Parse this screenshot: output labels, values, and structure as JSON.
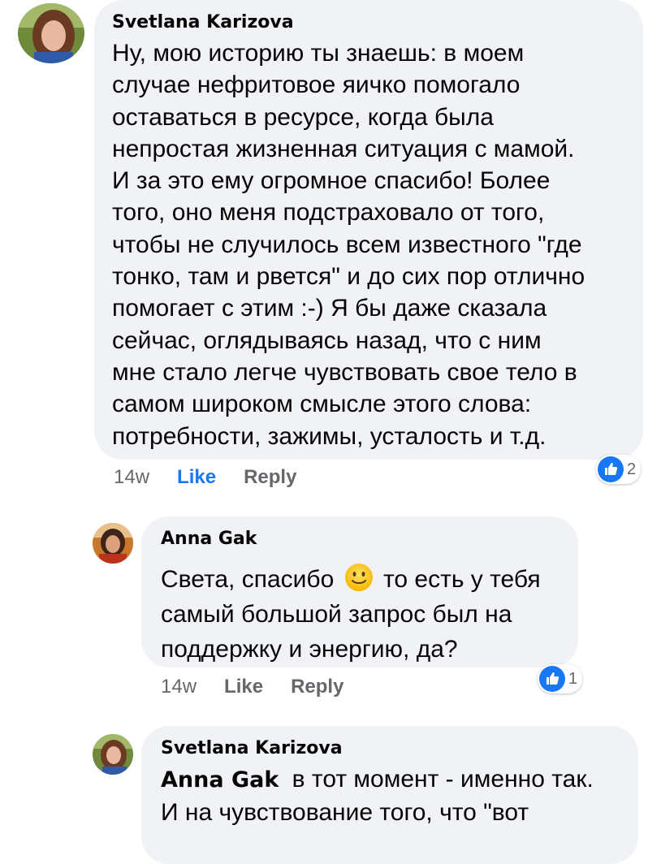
{
  "comments": [
    {
      "author": "Svetlana Karizova",
      "lines": [
        "Ну, мою историю ты знаешь: в моем",
        "случае нефритовое яичко помогало",
        "оставаться в ресурсе, когда была",
        "непростая жизненная ситуация с мамой.",
        "И за это ему огромное спасибо! Более",
        "того, оно меня подстраховало от того,",
        "чтобы не случилось всем известного \"где",
        "тонко, там и рвется\" и до сих пор отлично",
        "помогает с этим :-)  Я бы даже сказала",
        "сейчас, оглядываясь назад, что с ним",
        "мне стало легче чувствовать свое тело в",
        "самом широком смысле этого слова:",
        "потребности, зажимы, усталость и т.д."
      ],
      "time": "14w",
      "like_label": "Like",
      "reply_label": "Reply",
      "reaction_icon": "like-icon",
      "reaction_count": "2"
    },
    {
      "author": "Anna Gak",
      "line1_before": "Света, спасибо",
      "line1_emoji": "slightly-smiling-face-emoji",
      "line1_after": "то есть у тебя",
      "lines_rest": [
        "самый большой запрос был на",
        "поддержку и энергию, да?"
      ],
      "time": "14w",
      "like_label": "Like",
      "reply_label": "Reply",
      "reaction_icon": "like-icon",
      "reaction_count": "1"
    },
    {
      "author": "Svetlana Karizova",
      "mention": "Anna Gak",
      "line1_after": "в тот момент - именно так.",
      "lines_rest": [
        "И на чувствование того, что \"вот"
      ]
    }
  ],
  "colors": {
    "bubble": "#f0f2f5",
    "like_blue": "#1877f2",
    "meta_gray": "#65676b"
  }
}
